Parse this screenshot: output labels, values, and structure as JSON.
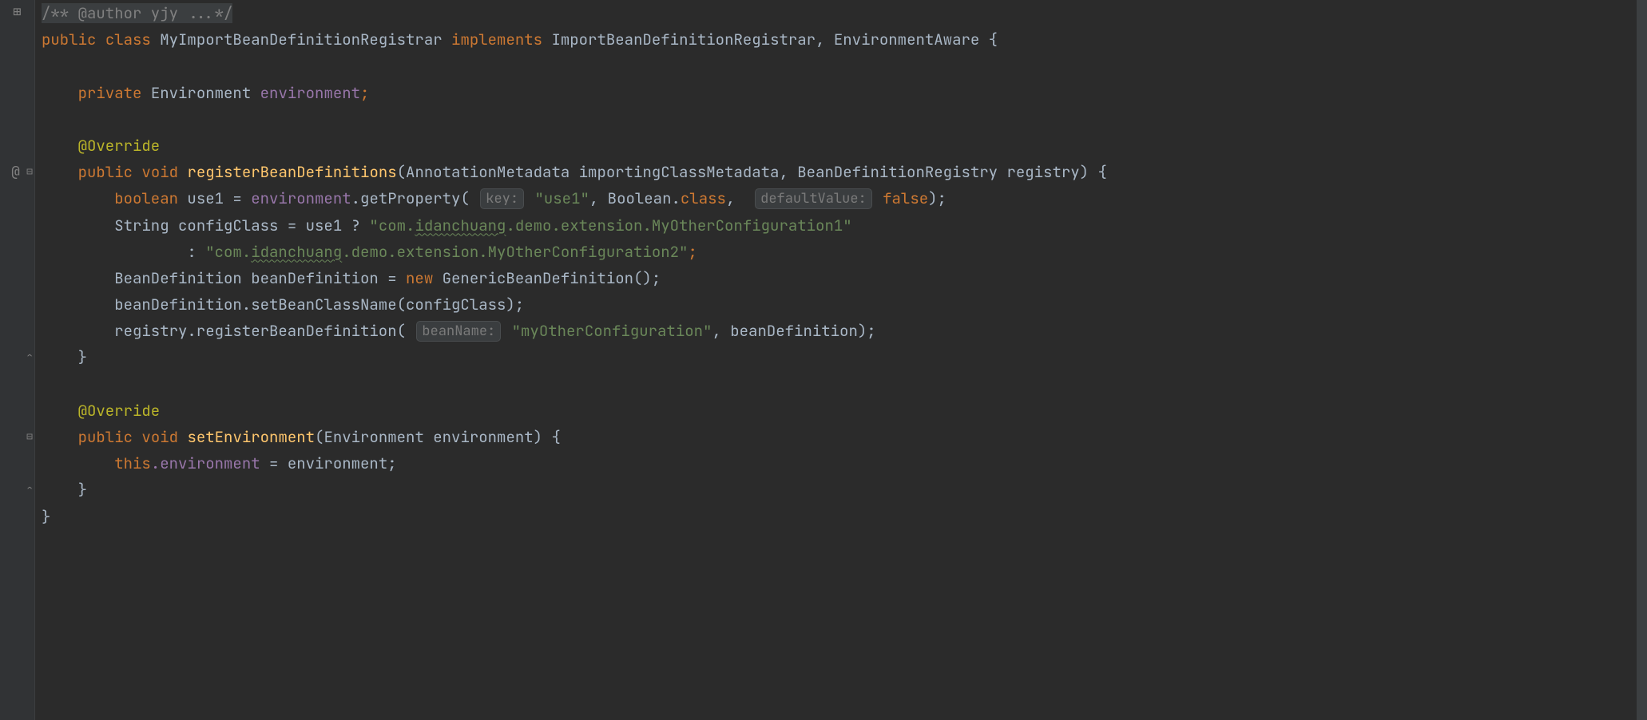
{
  "gutter": {
    "expand_icon": "⊞",
    "collapse_icon": "⊟",
    "at": "@",
    "method_mark": "↕"
  },
  "code": {
    "l1_doc": "/** @author yjy ...*/",
    "l2": {
      "public": "public",
      "class": "class",
      "name": "MyImportBeanDefinitionRegistrar",
      "implements": "implements",
      "ifaces": "ImportBeanDefinitionRegistrar, EnvironmentAware {"
    },
    "l4": {
      "private": "private",
      "type": "Environment",
      "field": "environment",
      "semi": ";"
    },
    "l6_ann": "@Override",
    "l7": {
      "public": "public",
      "void": "void",
      "name": "registerBeanDefinitions",
      "params": "(AnnotationMetadata importingClassMetadata, BeanDefinitionRegistry registry) {"
    },
    "l8": {
      "boolean": "boolean",
      "use1": "use1 = ",
      "env": "environment",
      "getProperty": ".getProperty(",
      "hint_key": "key:",
      "use1_str": " \"use1\"",
      "commaBool": ", Boolean.",
      "class_kw": "class",
      "comma2": ", ",
      "hint_def": "defaultValue:",
      "false": " false",
      "end": ");"
    },
    "l9": {
      "String": "String",
      "cfg": "configClass = use1 ? ",
      "str_pre": "\"com.",
      "idan": "idanchuang",
      "str_suf": ".demo.extension.MyOtherConfiguration1\""
    },
    "l10": {
      "colon": ": ",
      "str_pre": "\"com.",
      "idan": "idanchuang",
      "str_suf": ".demo.extension.MyOtherConfiguration2\"",
      "semi": ";"
    },
    "l11": {
      "text1": "BeanDefinition beanDefinition = ",
      "new": "new",
      "ctor": " GenericBeanDefinition();"
    },
    "l12": "beanDefinition.setBeanClassName(configClass);",
    "l13": {
      "text1": "registry.registerBeanDefinition(",
      "hint_bean": "beanName:",
      "str": " \"myOtherConfiguration\"",
      "text2": ", beanDefinition);"
    },
    "l14": "}",
    "l16_ann": "@Override",
    "l17": {
      "public": "public",
      "void": "void",
      "name": "setEnvironment",
      "params": "(Environment environment) {"
    },
    "l18": {
      "this": "this",
      "dot_field": ".environment",
      "assign": " = environment;"
    },
    "l19": "}",
    "l20": "}"
  }
}
